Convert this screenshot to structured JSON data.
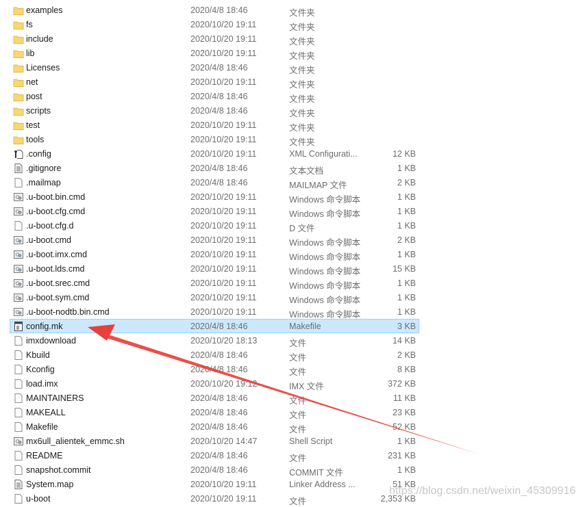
{
  "files": [
    {
      "name": "examples",
      "date": "2020/4/8 18:46",
      "type": "文件夹",
      "size": "",
      "icon": "folder-icon"
    },
    {
      "name": "fs",
      "date": "2020/10/20 19:11",
      "type": "文件夹",
      "size": "",
      "icon": "folder-icon"
    },
    {
      "name": "include",
      "date": "2020/10/20 19:11",
      "type": "文件夹",
      "size": "",
      "icon": "folder-icon"
    },
    {
      "name": "lib",
      "date": "2020/10/20 19:11",
      "type": "文件夹",
      "size": "",
      "icon": "folder-icon"
    },
    {
      "name": "Licenses",
      "date": "2020/4/8 18:46",
      "type": "文件夹",
      "size": "",
      "icon": "folder-icon"
    },
    {
      "name": "net",
      "date": "2020/10/20 19:11",
      "type": "文件夹",
      "size": "",
      "icon": "folder-icon"
    },
    {
      "name": "post",
      "date": "2020/4/8 18:46",
      "type": "文件夹",
      "size": "",
      "icon": "folder-icon"
    },
    {
      "name": "scripts",
      "date": "2020/4/8 18:46",
      "type": "文件夹",
      "size": "",
      "icon": "folder-icon"
    },
    {
      "name": "test",
      "date": "2020/10/20 19:11",
      "type": "文件夹",
      "size": "",
      "icon": "folder-icon"
    },
    {
      "name": "tools",
      "date": "2020/10/20 19:11",
      "type": "文件夹",
      "size": "",
      "icon": "folder-icon"
    },
    {
      "name": ".config",
      "date": "2020/10/20 19:11",
      "type": "XML Configurati...",
      "size": "12 KB",
      "icon": "config-file-icon"
    },
    {
      "name": ".gitignore",
      "date": "2020/4/8 18:46",
      "type": "文本文档",
      "size": "1 KB",
      "icon": "text-file-icon"
    },
    {
      "name": ".mailmap",
      "date": "2020/4/8 18:46",
      "type": "MAILMAP 文件",
      "size": "2 KB",
      "icon": "blank-file-icon"
    },
    {
      "name": ".u-boot.bin.cmd",
      "date": "2020/10/20 19:11",
      "type": "Windows 命令脚本",
      "size": "1 KB",
      "icon": "script-file-icon"
    },
    {
      "name": ".u-boot.cfg.cmd",
      "date": "2020/10/20 19:11",
      "type": "Windows 命令脚本",
      "size": "1 KB",
      "icon": "script-file-icon"
    },
    {
      "name": ".u-boot.cfg.d",
      "date": "2020/10/20 19:11",
      "type": "D 文件",
      "size": "1 KB",
      "icon": "blank-file-icon"
    },
    {
      "name": ".u-boot.cmd",
      "date": "2020/10/20 19:11",
      "type": "Windows 命令脚本",
      "size": "2 KB",
      "icon": "script-file-icon"
    },
    {
      "name": ".u-boot.imx.cmd",
      "date": "2020/10/20 19:11",
      "type": "Windows 命令脚本",
      "size": "1 KB",
      "icon": "script-file-icon"
    },
    {
      "name": ".u-boot.lds.cmd",
      "date": "2020/10/20 19:11",
      "type": "Windows 命令脚本",
      "size": "15 KB",
      "icon": "script-file-icon"
    },
    {
      "name": ".u-boot.srec.cmd",
      "date": "2020/10/20 19:11",
      "type": "Windows 命令脚本",
      "size": "1 KB",
      "icon": "script-file-icon"
    },
    {
      "name": ".u-boot.sym.cmd",
      "date": "2020/10/20 19:11",
      "type": "Windows 命令脚本",
      "size": "1 KB",
      "icon": "script-file-icon"
    },
    {
      "name": ".u-boot-nodtb.bin.cmd",
      "date": "2020/10/20 19:11",
      "type": "Windows 命令脚本",
      "size": "1 KB",
      "icon": "script-file-icon"
    },
    {
      "name": "config.mk",
      "date": "2020/4/8 18:46",
      "type": "Makefile",
      "size": "3 KB",
      "icon": "makefile-icon",
      "selected": true
    },
    {
      "name": "imxdownload",
      "date": "2020/10/20 18:13",
      "type": "文件",
      "size": "14 KB",
      "icon": "blank-file-icon"
    },
    {
      "name": "Kbuild",
      "date": "2020/4/8 18:46",
      "type": "文件",
      "size": "2 KB",
      "icon": "blank-file-icon"
    },
    {
      "name": "Kconfig",
      "date": "2020/4/8 18:46",
      "type": "文件",
      "size": "8 KB",
      "icon": "blank-file-icon"
    },
    {
      "name": "load.imx",
      "date": "2020/10/20 19:12",
      "type": "IMX 文件",
      "size": "372 KB",
      "icon": "blank-file-icon"
    },
    {
      "name": "MAINTAINERS",
      "date": "2020/4/8 18:46",
      "type": "文件",
      "size": "11 KB",
      "icon": "blank-file-icon"
    },
    {
      "name": "MAKEALL",
      "date": "2020/4/8 18:46",
      "type": "文件",
      "size": "23 KB",
      "icon": "blank-file-icon"
    },
    {
      "name": "Makefile",
      "date": "2020/4/8 18:46",
      "type": "文件",
      "size": "52 KB",
      "icon": "blank-file-icon"
    },
    {
      "name": "mx6ull_alientek_emmc.sh",
      "date": "2020/10/20 14:47",
      "type": "Shell Script",
      "size": "1 KB",
      "icon": "script-file-icon"
    },
    {
      "name": "README",
      "date": "2020/4/8 18:46",
      "type": "文件",
      "size": "231 KB",
      "icon": "blank-file-icon"
    },
    {
      "name": "snapshot.commit",
      "date": "2020/4/8 18:46",
      "type": "COMMIT 文件",
      "size": "1 KB",
      "icon": "blank-file-icon"
    },
    {
      "name": "System.map",
      "date": "2020/10/20 19:11",
      "type": "Linker Address ...",
      "size": "51 KB",
      "icon": "text-file-icon"
    },
    {
      "name": "u-boot",
      "date": "2020/10/20 19:11",
      "type": "文件",
      "size": "2,353 KB",
      "icon": "blank-file-icon"
    }
  ],
  "watermark": "https://blog.csdn.net/weixin_45309916",
  "colors": {
    "selection_bg": "#cce8ff",
    "selection_border": "#99d1ff",
    "arrow": "#e8403a",
    "folder": "#f8d775"
  }
}
